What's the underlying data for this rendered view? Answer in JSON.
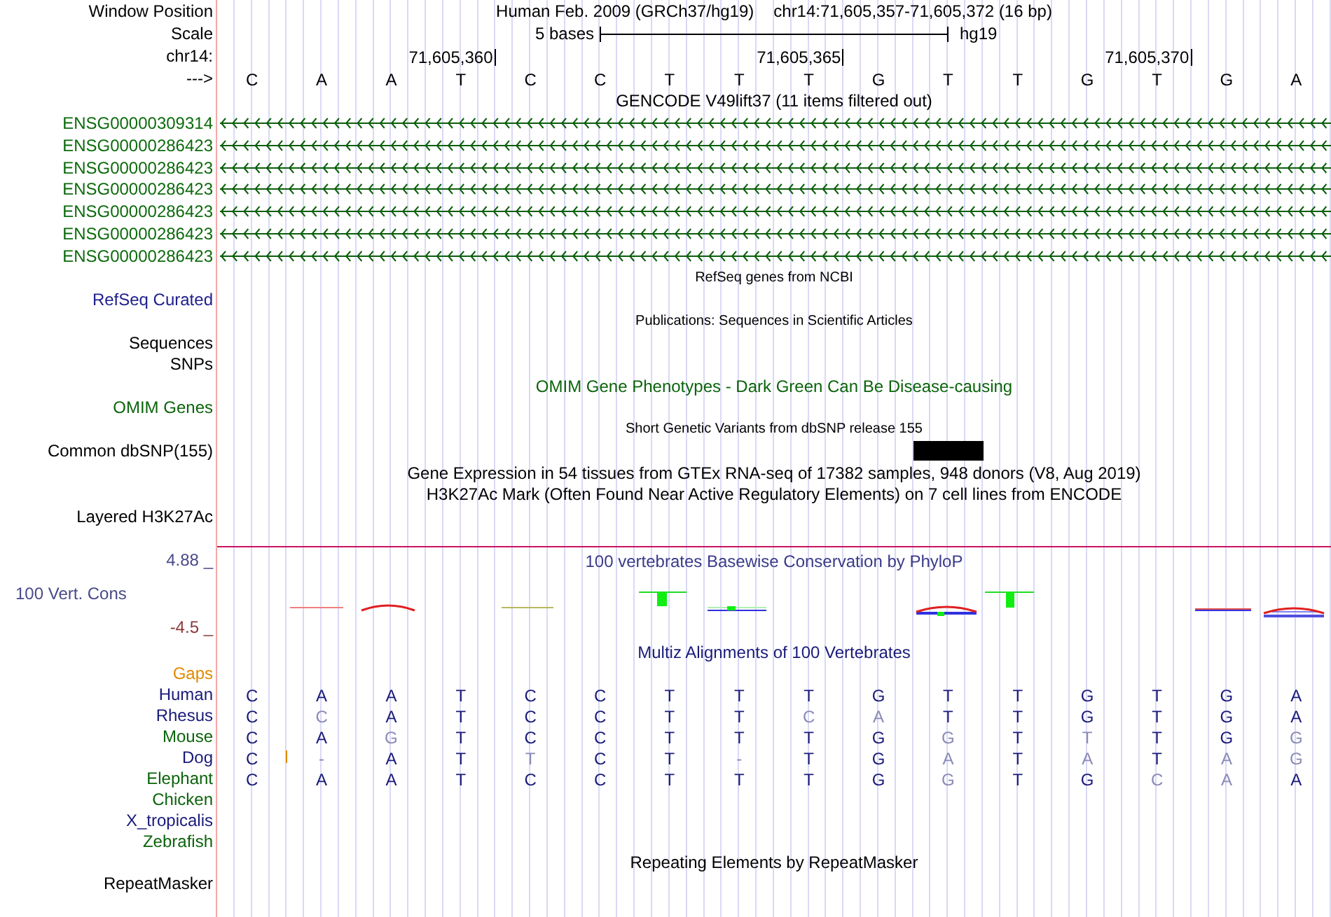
{
  "header": {
    "position_label": "Window Position",
    "assembly": "Human Feb. 2009 (GRCh37/hg19)",
    "position": "chr14:71,605,357-71,605,372 (16 bp)",
    "scale_label": "Scale",
    "scale_text": "5 bases",
    "scale_db": "hg19",
    "chrom_label": "chr14:",
    "strand_label": "--->"
  },
  "reference": [
    {
      "base": "C"
    },
    {
      "base": "A"
    },
    {
      "base": "A"
    },
    {
      "base": "T",
      "tick": "71,605,360"
    },
    {
      "base": "C"
    },
    {
      "base": "C"
    },
    {
      "base": "T"
    },
    {
      "base": "T"
    },
    {
      "base": "T",
      "tick": "71,605,365"
    },
    {
      "base": "G"
    },
    {
      "base": "T",
      "common_snp": true
    },
    {
      "base": "T"
    },
    {
      "base": "G"
    },
    {
      "base": "T",
      "tick": "71,605,370"
    },
    {
      "base": "G"
    },
    {
      "base": "A"
    }
  ],
  "gencode": {
    "title": "GENCODE V49lift37 (11 items filtered out)",
    "genes": [
      "ENSG00000309314",
      "ENSG00000286423",
      "ENSG00000286423",
      "ENSG00000286423",
      "ENSG00000286423",
      "ENSG00000286423",
      "ENSG00000286423"
    ]
  },
  "tracks": [
    {
      "kind": "small-title",
      "text": "RefSeq genes from NCBI",
      "color": "#000000"
    },
    {
      "kind": "label",
      "text": "RefSeq Curated",
      "color": "#20208c"
    },
    {
      "kind": "small-title",
      "text": "Publications: Sequences in Scientific Articles",
      "color": "#000000"
    },
    {
      "kind": "label",
      "text": "Sequences",
      "color": "#000000"
    },
    {
      "kind": "label",
      "text": "SNPs",
      "color": "#000000"
    },
    {
      "kind": "title",
      "text": "OMIM Gene Phenotypes - Dark Green Can Be Disease-causing",
      "color": "#0b640b"
    },
    {
      "kind": "label",
      "text": "OMIM Genes",
      "color": "#0b640b"
    },
    {
      "kind": "small-title",
      "text": "Short Genetic Variants from dbSNP release 155",
      "color": "#000000"
    },
    {
      "kind": "snp-label",
      "text": "Common dbSNP(155)",
      "color": "#000000"
    },
    {
      "kind": "title",
      "text": "Gene Expression in 54 tissues from GTEx RNA-seq of 17382 samples, 948 donors (V8, Aug 2019)",
      "color": "#000000"
    },
    {
      "kind": "title",
      "text": "H3K27Ac Mark (Often Found Near Active Regulatory Elements) on 7 cell lines from ENCODE",
      "color": "#000000"
    },
    {
      "kind": "label",
      "text": "Layered H3K27Ac",
      "color": "#000000"
    }
  ],
  "conservation": {
    "title": "100 vertebrates Basewise Conservation by PhyloP",
    "label": "100 Vert. Cons",
    "max": "4.88 _",
    "min": "-4.5 _"
  },
  "multiz": {
    "title": "Multiz Alignments of 100 Vertebrates",
    "gaps_label": "Gaps",
    "species": [
      {
        "name": "Human",
        "color": "#1a1a7a",
        "bases": [
          {
            "base": "C",
            "match": true
          },
          {
            "base": "A",
            "match": true
          },
          {
            "base": "A",
            "match": true
          },
          {
            "base": "T",
            "match": true
          },
          {
            "base": "C",
            "match": true
          },
          {
            "base": "C",
            "match": true
          },
          {
            "base": "T",
            "match": true
          },
          {
            "base": "T",
            "match": true
          },
          {
            "base": "T",
            "match": true
          },
          {
            "base": "G",
            "match": true
          },
          {
            "base": "T",
            "match": true
          },
          {
            "base": "T",
            "match": true
          },
          {
            "base": "G",
            "match": true
          },
          {
            "base": "T",
            "match": true
          },
          {
            "base": "G",
            "match": true
          },
          {
            "base": "A",
            "match": true
          }
        ]
      },
      {
        "name": "Rhesus",
        "color": "#1a1a7a",
        "bases": [
          {
            "base": "C",
            "match": true
          },
          {
            "base": "C",
            "match": false
          },
          {
            "base": "A",
            "match": true
          },
          {
            "base": "T",
            "match": true
          },
          {
            "base": "C",
            "match": true
          },
          {
            "base": "C",
            "match": true
          },
          {
            "base": "T",
            "match": true
          },
          {
            "base": "T",
            "match": true
          },
          {
            "base": "C",
            "match": false
          },
          {
            "base": "A",
            "match": false
          },
          {
            "base": "T",
            "match": true
          },
          {
            "base": "T",
            "match": true
          },
          {
            "base": "G",
            "match": true
          },
          {
            "base": "T",
            "match": true
          },
          {
            "base": "G",
            "match": true
          },
          {
            "base": "A",
            "match": true
          }
        ]
      },
      {
        "name": "Mouse",
        "color": "#0b640b",
        "bases": [
          {
            "base": "C",
            "match": true
          },
          {
            "base": "A",
            "match": true
          },
          {
            "base": "G",
            "match": false
          },
          {
            "base": "T",
            "match": true
          },
          {
            "base": "C",
            "match": true
          },
          {
            "base": "C",
            "match": true
          },
          {
            "base": "T",
            "match": true
          },
          {
            "base": "T",
            "match": true
          },
          {
            "base": "T",
            "match": true
          },
          {
            "base": "G",
            "match": true
          },
          {
            "base": "G",
            "match": false
          },
          {
            "base": "T",
            "match": true
          },
          {
            "base": "T",
            "match": false
          },
          {
            "base": "T",
            "match": true
          },
          {
            "base": "G",
            "match": true
          },
          {
            "base": "G",
            "match": false
          }
        ]
      },
      {
        "name": "Dog",
        "color": "#1a1a7a",
        "bases": [
          {
            "base": "C",
            "match": true
          },
          {
            "base": "-",
            "match": false,
            "insertion_before": true
          },
          {
            "base": "A",
            "match": true
          },
          {
            "base": "T",
            "match": true
          },
          {
            "base": "T",
            "match": false
          },
          {
            "base": "C",
            "match": true
          },
          {
            "base": "T",
            "match": true
          },
          {
            "base": "-",
            "match": false
          },
          {
            "base": "T",
            "match": true
          },
          {
            "base": "G",
            "match": true
          },
          {
            "base": "A",
            "match": false
          },
          {
            "base": "T",
            "match": true
          },
          {
            "base": "A",
            "match": false
          },
          {
            "base": "T",
            "match": true
          },
          {
            "base": "A",
            "match": false
          },
          {
            "base": "G",
            "match": false
          }
        ]
      },
      {
        "name": "Elephant",
        "color": "#0b640b",
        "bases": [
          {
            "base": "C",
            "match": true
          },
          {
            "base": "A",
            "match": true
          },
          {
            "base": "A",
            "match": true
          },
          {
            "base": "T",
            "match": true
          },
          {
            "base": "C",
            "match": true
          },
          {
            "base": "C",
            "match": true
          },
          {
            "base": "T",
            "match": true
          },
          {
            "base": "T",
            "match": true
          },
          {
            "base": "T",
            "match": true
          },
          {
            "base": "G",
            "match": true
          },
          {
            "base": "G",
            "match": false
          },
          {
            "base": "T",
            "match": true
          },
          {
            "base": "G",
            "match": true
          },
          {
            "base": "C",
            "match": false
          },
          {
            "base": "A",
            "match": false
          },
          {
            "base": "A",
            "match": true
          }
        ]
      },
      {
        "name": "Chicken",
        "color": "#0b640b"
      },
      {
        "name": "X_tropicalis",
        "color": "#1a1a7a"
      },
      {
        "name": "Zebrafish",
        "color": "#0b640b"
      }
    ]
  },
  "repeats": {
    "title": "Repeating Elements by RepeatMasker",
    "label": "RepeatMasker"
  }
}
